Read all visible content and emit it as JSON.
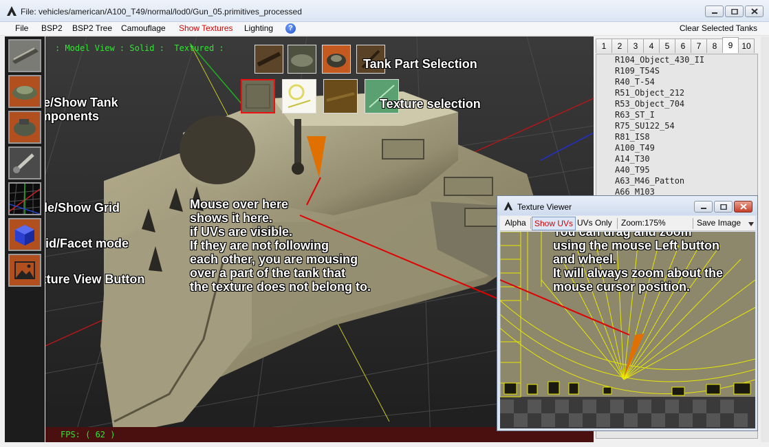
{
  "window": {
    "title": "File: vehicles/american/A100_T49/normal/lod0/Gun_05.primitives_processed"
  },
  "menu": {
    "items": [
      "File",
      "BSP2",
      "BSP2 Tree",
      "Camouflage",
      "Show Textures",
      "Lighting"
    ],
    "right_action": "Clear Selected Tanks"
  },
  "toolbar": {
    "buttons": [
      "tank-hull-button",
      "tank-turret-button",
      "tank-turret-top-button",
      "tank-gun-button",
      "grid-button",
      "solid-facet-button",
      "texture-view-button"
    ]
  },
  "viewport": {
    "status_line": ": Model View : Solid :  Textured :",
    "fps_label": "FPS: ( 62 )"
  },
  "annotations": {
    "tank_part_selection": "Tank Part Selection",
    "texture_selection": "Texture selection",
    "hide_show_components": [
      "Hide/Show Tank",
      "Components"
    ],
    "hide_show_grid": "Hide/Show Grid",
    "solid_facet": "Solid/Facet mode",
    "texture_view_button": "Texture View Button",
    "mouse_over": [
      "Mouse over here",
      "shows it here.",
      "if UVs are visible.",
      "If they are not following",
      "each other, you are mousing",
      "over a part of the tank that",
      "the texture does not belong to."
    ],
    "drag_zoom": [
      "You can  drag and zoom",
      "using the mouse Left button",
      "and wheel.",
      "It will always zoom about the",
      "mouse cursor position."
    ]
  },
  "right_panel": {
    "tabs": [
      "1",
      "2",
      "3",
      "4",
      "5",
      "6",
      "7",
      "8",
      "9",
      "10"
    ],
    "active_tab": "9",
    "tanks": [
      "R104_Object_430_II",
      "R109_T54S",
      "R40_T-54",
      "R51_Object_212",
      "R53_Object_704",
      "R63_ST_I",
      "R75_SU122_54",
      "R81_IS8",
      "A100_T49",
      "A14_T30",
      "A40_T95",
      "A63_M46_Patton",
      "A66_M103"
    ]
  },
  "texture_viewer": {
    "title": "Texture Viewer",
    "toolbar": {
      "alpha": "Alpha",
      "show_uvs": "Show UVs",
      "uvs_only": "UVs Only",
      "zoom": "Zoom:175%",
      "save_image": "Save Image"
    }
  },
  "colors": {
    "status_green": "#2ee82e",
    "menu_active_red": "#d40000",
    "uv_yellow": "#e8e800",
    "annotation_line_red": "#e00000",
    "highlight_orange": "#e07000"
  }
}
